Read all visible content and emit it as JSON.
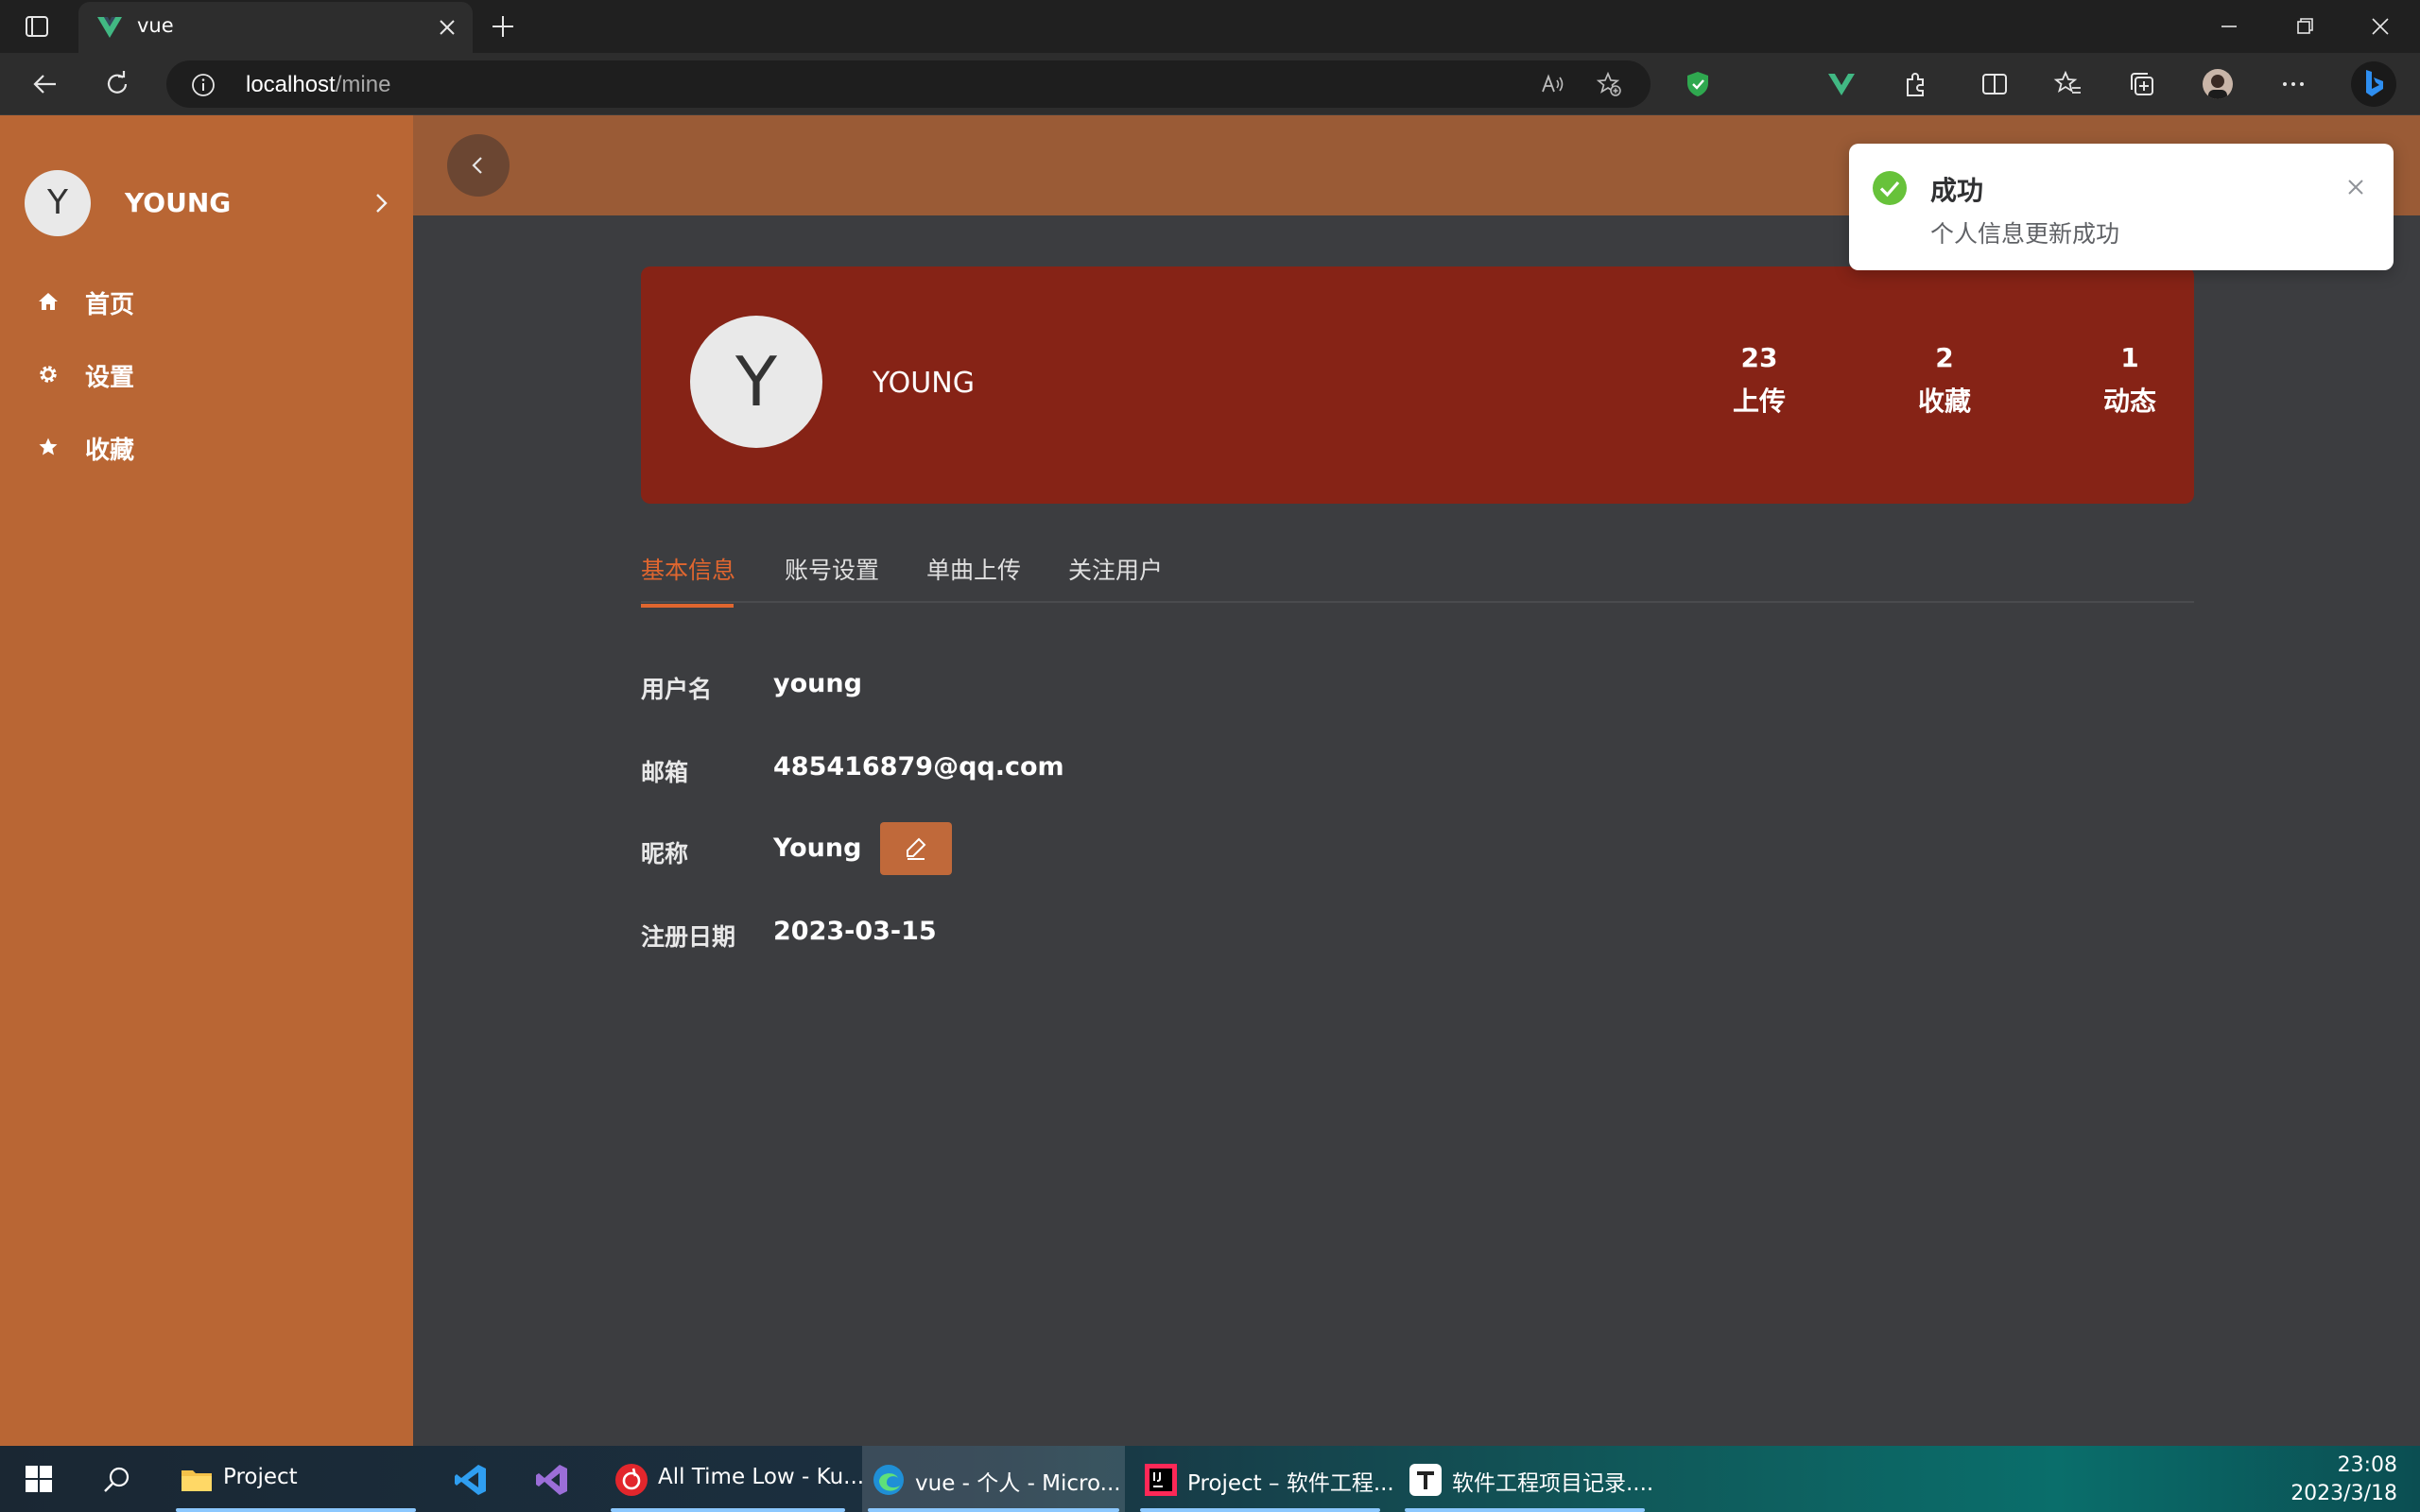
{
  "browser": {
    "tab_title": "vue",
    "url_host": "localhost",
    "url_path": "/mine"
  },
  "sidebar": {
    "avatar_letter": "Y",
    "user_name": "YOUNG",
    "items": [
      {
        "label": "首页",
        "icon": "home-icon"
      },
      {
        "label": "设置",
        "icon": "gear-icon"
      },
      {
        "label": "收藏",
        "icon": "star-icon"
      }
    ]
  },
  "profile": {
    "avatar_letter": "Y",
    "name": "YOUNG",
    "stats": [
      {
        "value": "23",
        "label": "上传"
      },
      {
        "value": "2",
        "label": "收藏"
      },
      {
        "value": "1",
        "label": "动态"
      }
    ]
  },
  "tabs": [
    {
      "label": "基本信息",
      "active": true
    },
    {
      "label": "账号设置",
      "active": false
    },
    {
      "label": "单曲上传",
      "active": false
    },
    {
      "label": "关注用户",
      "active": false
    }
  ],
  "info": {
    "username_label": "用户名",
    "username_value": "young",
    "email_label": "邮箱",
    "email_value": "485416879@qq.com",
    "nickname_label": "昵称",
    "nickname_value": "Young",
    "regdate_label": "注册日期",
    "regdate_value": "2023-03-15"
  },
  "toast": {
    "title": "成功",
    "message": "个人信息更新成功"
  },
  "taskbar": {
    "apps": [
      {
        "label": "Project"
      },
      {
        "label": ""
      },
      {
        "label": ""
      },
      {
        "label": "All Time Low - Ku..."
      },
      {
        "label": "vue - 个人 - Micro..."
      },
      {
        "label": "Project – 软件工程..."
      },
      {
        "label": "软件工程项目记录...."
      }
    ],
    "time": "23:08",
    "date": "2023/3/18"
  },
  "colors": {
    "sidebar": "#b96634",
    "topbar": "#9a5b36",
    "card": "#862316",
    "accent": "#e0662f",
    "content_bg": "#3c3d40",
    "success": "#67c23a"
  }
}
